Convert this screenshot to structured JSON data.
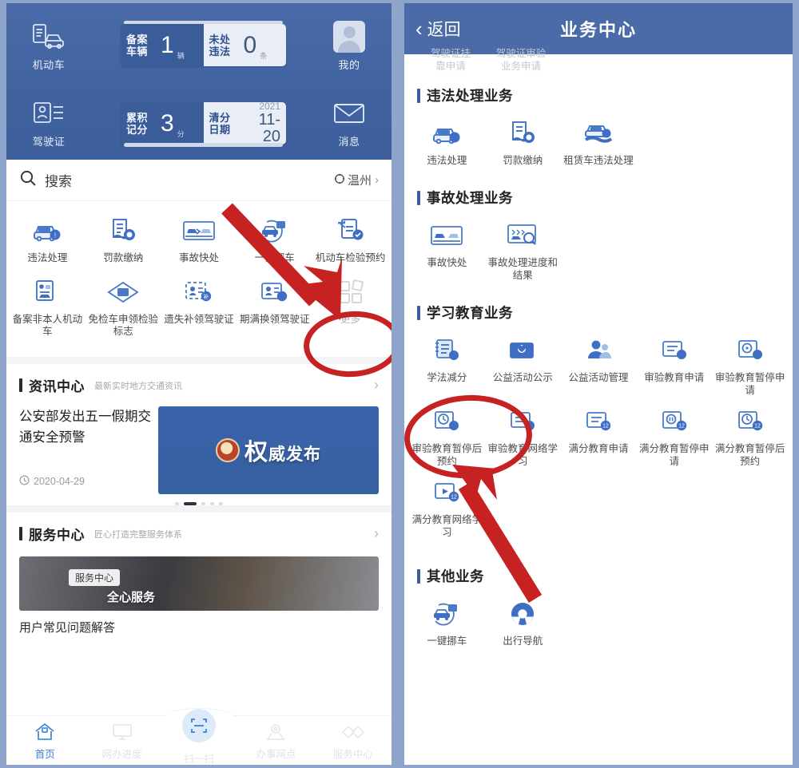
{
  "left": {
    "hero": {
      "side_items": [
        {
          "label": "机动车",
          "icon": "vehicle-doc-icon"
        },
        {
          "label": "驾驶证",
          "icon": "license-icon"
        },
        {
          "label": "我的",
          "icon": "avatar-icon"
        },
        {
          "label": "消息",
          "icon": "envelope-icon"
        }
      ],
      "plate_vehicle": {
        "left_label_1": "备案",
        "left_label_2": "车辆",
        "left_value": "1",
        "left_unit": "辆",
        "right_label_1": "未处",
        "right_label_2": "违法",
        "right_value": "0",
        "right_unit": "条"
      },
      "plate_points": {
        "left_label_1": "累积",
        "left_label_2": "记分",
        "left_value": "3",
        "left_unit": "分",
        "right_label_1": "清分",
        "right_label_2": "日期",
        "year": "2021",
        "monthday": "11-20"
      }
    },
    "search": {
      "placeholder": "搜索",
      "icon": "search-icon",
      "city": "温州",
      "city_icon": "location-icon",
      "chevron": "›"
    },
    "grid": [
      {
        "label": "违法处理",
        "icon": "car-warning-icon",
        "muted": false
      },
      {
        "label": "罚款缴纳",
        "icon": "document-pay-icon",
        "muted": false
      },
      {
        "label": "事故快处",
        "icon": "accident-icon",
        "muted": false
      },
      {
        "label": "一键挪车",
        "icon": "move-car-icon",
        "muted": false
      },
      {
        "label": "机动车检验预约",
        "icon": "inspection-appointment-icon",
        "muted": false
      },
      {
        "label": "备案非本人机动车",
        "icon": "record-other-vehicle-icon",
        "muted": false
      },
      {
        "label": "免检车申领检验标志",
        "icon": "exempt-mark-icon",
        "muted": false
      },
      {
        "label": "遗失补领驾驶证",
        "icon": "lost-license-icon",
        "muted": false
      },
      {
        "label": "期满换领驾驶证",
        "icon": "renew-license-icon",
        "muted": false
      },
      {
        "label": "更多",
        "icon": "more-grid-icon",
        "muted": true
      }
    ],
    "news_section": {
      "title": "资讯中心",
      "subtitle": "最新实时地方交通资讯",
      "chevron": "›",
      "item_title": "公安部发出五一假期交通安全预警",
      "item_date": "2020-04-29",
      "clock_icon": "clock-icon",
      "banner_text_main": "权",
      "banner_text_rest": "威发布",
      "banner_seal_icon": "police-emblem-icon",
      "dots_total": 5,
      "dots_active_index": 1
    },
    "service_section": {
      "title": "服务中心",
      "subtitle": "匠心打造完整服务体系",
      "chevron": "›",
      "image_chip": "服务中心",
      "image_sub": "全心服务",
      "faq": "用户常见问题解答"
    },
    "tabbar": [
      {
        "label": "首页",
        "icon": "home-icon",
        "active": true
      },
      {
        "label": "网办进度",
        "icon": "monitor-icon",
        "active": false
      },
      {
        "label": "扫一扫",
        "icon": "scan-icon",
        "active": false
      },
      {
        "label": "办事网点",
        "icon": "map-pin-icon",
        "active": false
      },
      {
        "label": "服务中心",
        "icon": "diamond-service-icon",
        "active": false
      }
    ]
  },
  "right": {
    "header": {
      "back_label": "返回",
      "back_icon": "chevron-left-icon",
      "title": "业务中心"
    },
    "cut_items": [
      {
        "line1": "驾驶证挂",
        "line2": "靠申请"
      },
      {
        "line1": "驾驶证审验",
        "line2": "业务申请"
      }
    ],
    "sections": [
      {
        "title": "违法处理业务",
        "items": [
          {
            "label": "违法处理",
            "icon": "car-warning-icon"
          },
          {
            "label": "罚款缴纳",
            "icon": "document-pay-icon"
          },
          {
            "label": "租赁车违法处理",
            "icon": "rental-car-icon"
          }
        ]
      },
      {
        "title": "事故处理业务",
        "items": [
          {
            "label": "事故快处",
            "icon": "accident-icon"
          },
          {
            "label": "事故处理进度和结果",
            "icon": "accident-progress-icon"
          }
        ]
      },
      {
        "title": "学习教育业务",
        "items": [
          {
            "label": "学法减分",
            "icon": "study-deduct-icon"
          },
          {
            "label": "公益活动公示",
            "icon": "public-welfare-notice-icon"
          },
          {
            "label": "公益活动管理",
            "icon": "public-welfare-manage-icon"
          },
          {
            "label": "审验教育申请",
            "icon": "review-education-apply-icon"
          },
          {
            "label": "审验教育暂停申请",
            "icon": "review-education-pause-icon"
          },
          {
            "label": "审验教育暂停后预约",
            "icon": "review-education-resume-icon"
          },
          {
            "label": "审验教育网络学习",
            "icon": "review-education-online-icon"
          },
          {
            "label": "满分教育申请",
            "icon": "full-mark-apply-icon"
          },
          {
            "label": "满分教育暂停申请",
            "icon": "full-mark-pause-icon"
          },
          {
            "label": "满分教育暂停后预约",
            "icon": "full-mark-resume-icon"
          },
          {
            "label": "满分教育网络学习",
            "icon": "full-mark-online-icon"
          }
        ]
      },
      {
        "title": "其他业务",
        "items": [
          {
            "label": "一键挪车",
            "icon": "move-car-icon"
          },
          {
            "label": "出行导航",
            "icon": "steering-wheel-icon"
          }
        ]
      }
    ]
  },
  "annotations": {
    "highlight_color": "#c62222",
    "items": [
      {
        "name": "ellipse-around-more",
        "target": "更多"
      },
      {
        "name": "arrow-to-more",
        "target": "更多"
      },
      {
        "name": "ellipse-around-study-deduct",
        "target": "学法减分"
      },
      {
        "name": "arrow-to-study-deduct",
        "target": "学法减分"
      }
    ]
  }
}
